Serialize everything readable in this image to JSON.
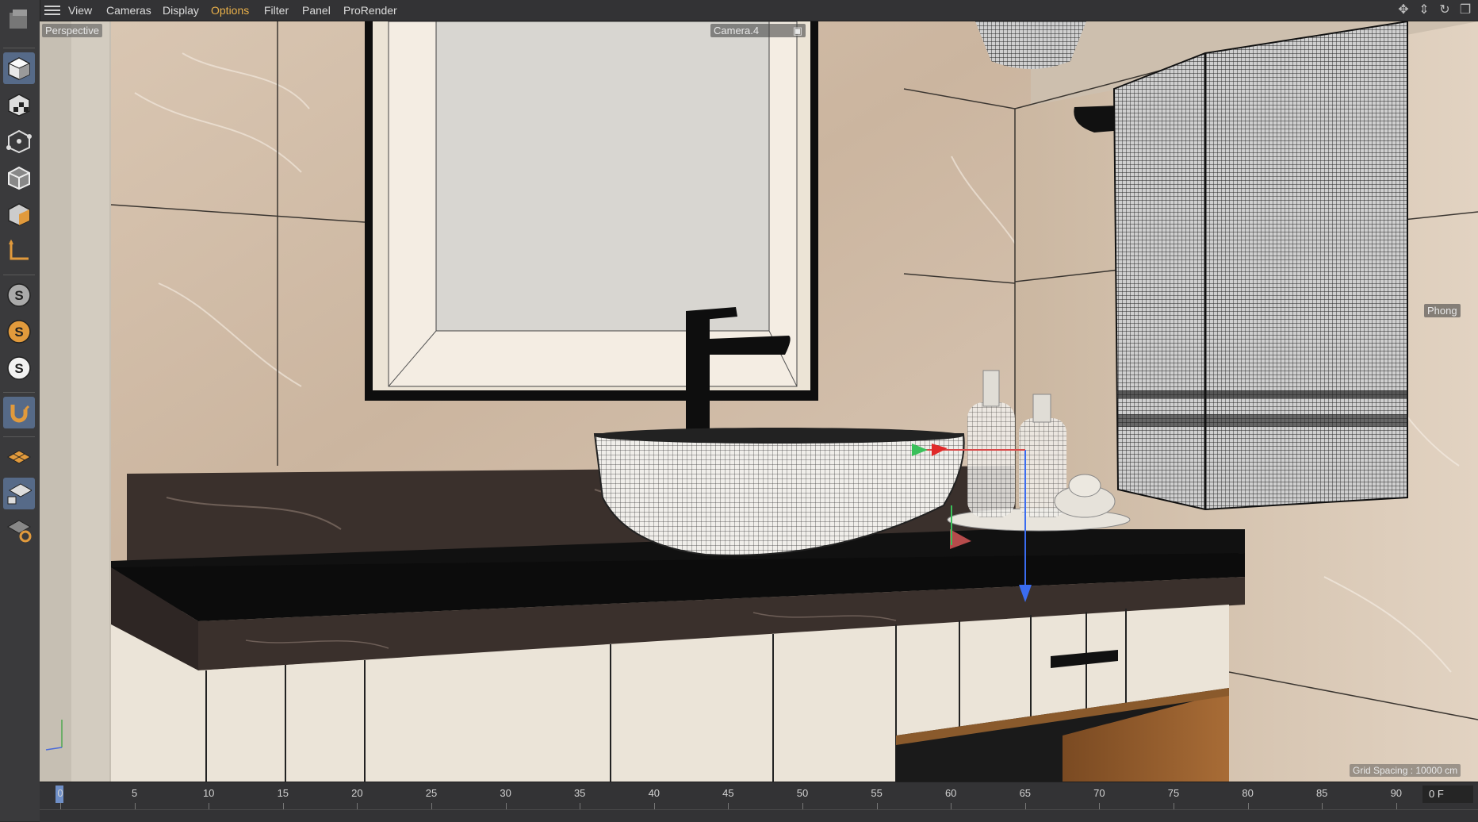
{
  "menubar": {
    "items": [
      "View",
      "Cameras",
      "Display",
      "Options",
      "Filter",
      "Panel",
      "ProRender"
    ],
    "active_item": "Options"
  },
  "viewport": {
    "projection_label": "Perspective",
    "camera_label": "Camera.4",
    "shading_label": "Phong",
    "grid_spacing": "Grid Spacing : 10000 cm"
  },
  "timeline": {
    "ticks": [
      "0",
      "5",
      "10",
      "15",
      "20",
      "25",
      "30",
      "35",
      "40",
      "45",
      "50",
      "55",
      "60",
      "65",
      "70",
      "75",
      "80",
      "85",
      "90"
    ],
    "current_frame": "0 F"
  },
  "toolbar": {
    "tools": [
      "model-mode",
      "texture-mode",
      "points-mode",
      "edges-mode",
      "polygons-mode",
      "axis-mode",
      "snap-s-gray",
      "snap-s-orange",
      "snap-s-white",
      "magnet",
      "workplane",
      "workplane-lock",
      "workplane-snap"
    ]
  },
  "colors": {
    "accent": "#e9b04a",
    "selected_tool": "#566a88"
  }
}
